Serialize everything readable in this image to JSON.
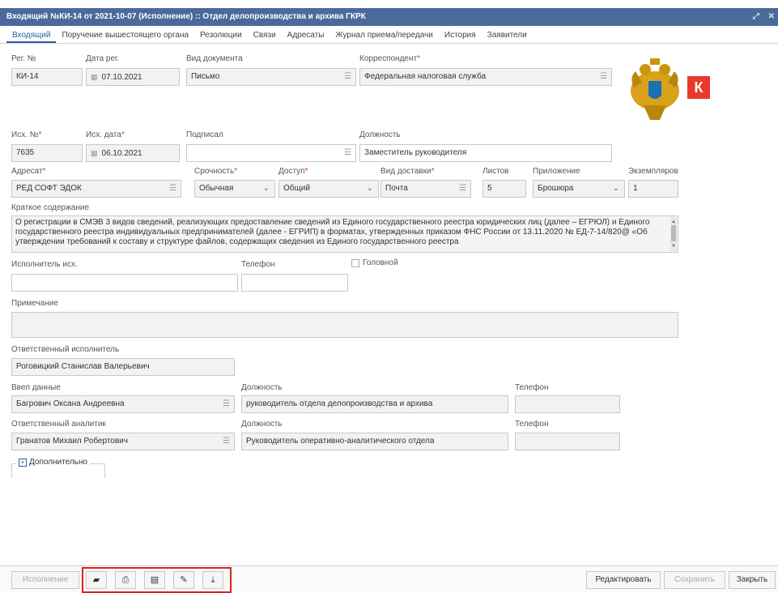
{
  "window": {
    "title": "Входящий №КИ-14 от 2021-10-07 (Исполнение) :: Отдел делопроизводства и архива ГКРК",
    "resize_icon": "resize-icon",
    "close_icon": "close-icon"
  },
  "tabs": [
    {
      "label": "Входящий",
      "active": true
    },
    {
      "label": "Поручение вышестоящего органа"
    },
    {
      "label": "Резолюции"
    },
    {
      "label": "Связи"
    },
    {
      "label": "Адресаты"
    },
    {
      "label": "Журнал приема/передачи"
    },
    {
      "label": "История"
    },
    {
      "label": "Заявители"
    }
  ],
  "form": {
    "reg_no": {
      "label": "Рег. №",
      "value": "КИ-14"
    },
    "reg_date": {
      "label": "Дата рег.",
      "value": "07.10.2021"
    },
    "doc_type": {
      "label": "Вид документа",
      "value": "Письмо"
    },
    "correspondent": {
      "label": "Корреспондент",
      "value": "Федеральная налоговая служба"
    },
    "out_no": {
      "label": "Исх. №",
      "value": "7635"
    },
    "out_date": {
      "label": "Исх. дата",
      "value": "06.10.2021"
    },
    "signed": {
      "label": "Подписал",
      "value": ""
    },
    "position": {
      "label": "Должность",
      "value": "Заместитель руководителя"
    },
    "addressee": {
      "label": "Адресат",
      "value": "РЕД СОФТ ЭДОК"
    },
    "urgency": {
      "label": "Срочность",
      "value": "Обычная"
    },
    "access": {
      "label": "Доступ",
      "value": "Общий"
    },
    "delivery": {
      "label": "Вид доставки",
      "value": "Почта"
    },
    "sheets": {
      "label": "Листов",
      "value": "5"
    },
    "attachment": {
      "label": "Приложение",
      "value": "Брошюра"
    },
    "copies": {
      "label": "Экземпляров",
      "value": "1"
    },
    "summary": {
      "label": "Краткое содержание",
      "value": "О регистрации в СМЭВ 3 видов сведений, реализующих предоставление сведений из Единого государственного реестра юридических лиц (далее – ЕГРЮЛ) и Единого государственного реестра индивидуальных предпринимателей (далее - ЕГРИП) в форматах, утвержденных приказом ФНС России от 13.11.2020 № ЕД-7-14/820@ «Об утверждении требований к составу и структуре файлов, содержащих сведения из Единого государственного реестра"
    },
    "executor_out": {
      "label": "Исполнитель исх.",
      "value": ""
    },
    "phone1": {
      "label": "Телефон",
      "value": ""
    },
    "head": {
      "label": "Головной",
      "checked": false
    },
    "note": {
      "label": "Примечание",
      "value": ""
    },
    "responsible": {
      "label": "Ответственный исполнитель",
      "value": "Роговицкий Станислав Валерьевич"
    },
    "entered_by": {
      "label": "Ввел данные",
      "value": "Багрович Оксана Андреевна"
    },
    "entered_position": {
      "label": "Должность",
      "value": "руководитель отдела делопроизводства и архива"
    },
    "entered_phone": {
      "label": "Телефон",
      "value": ""
    },
    "analyst": {
      "label": "Ответственный аналитик",
      "value": "Гранатов Михаил Робертович"
    },
    "analyst_position": {
      "label": "Должность",
      "value": "Руководитель оперативно-аналитического отдела"
    },
    "analyst_phone": {
      "label": "Телефон",
      "value": ""
    },
    "more": {
      "label": "Дополнительно"
    }
  },
  "logo": {
    "emblem_icon": "eagle-emblem-icon",
    "k_badge": "К"
  },
  "toolbar": {
    "execute": "Исполнение",
    "icons": [
      "folder-icon",
      "print-icon",
      "card-icon",
      "attach-icon",
      "download-icon"
    ],
    "edit": "Редактировать",
    "save": "Сохранить",
    "close": "Закрыть"
  },
  "colors": {
    "titlebar": "#4a6a9b",
    "accent": "#2a5db0",
    "required": "#e33333",
    "highlight_box": "#e02020",
    "logo_red": "#e8392b"
  }
}
